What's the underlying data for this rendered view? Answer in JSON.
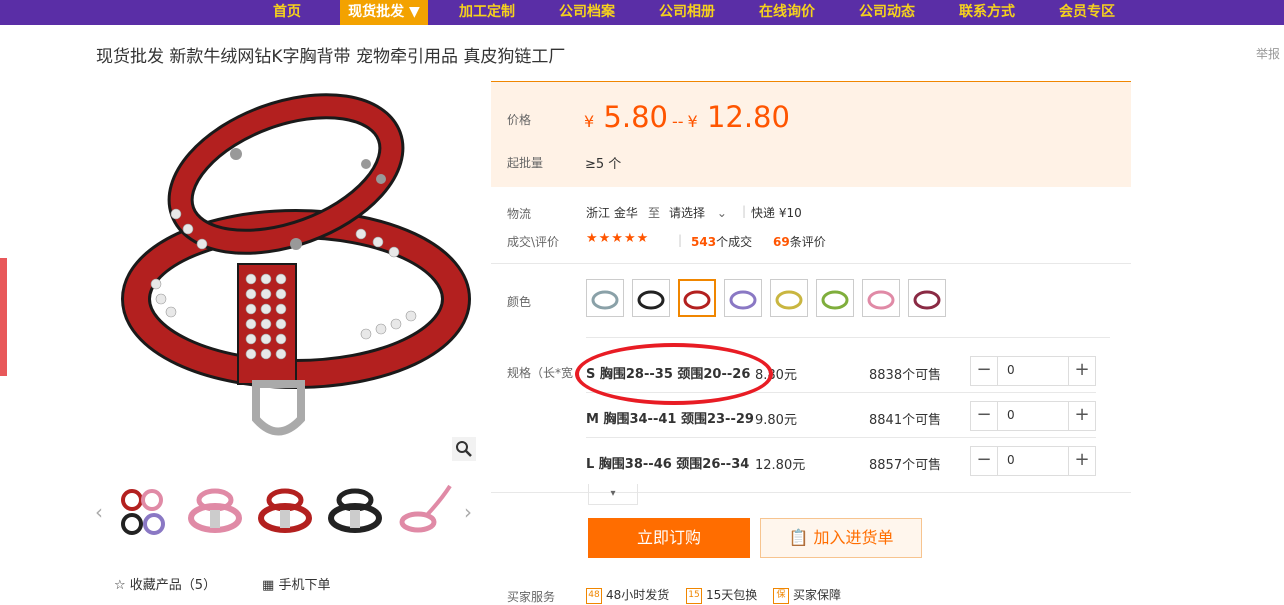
{
  "nav": {
    "items": [
      {
        "label": "首页"
      },
      {
        "label": "现货批发 ▼"
      },
      {
        "label": "加工定制"
      },
      {
        "label": "公司档案"
      },
      {
        "label": "公司相册"
      },
      {
        "label": "在线询价"
      },
      {
        "label": "公司动态"
      },
      {
        "label": "联系方式"
      },
      {
        "label": "会员专区"
      }
    ]
  },
  "product": {
    "title": "现货批发 新款牛绒网钻K字胸背带 宠物牵引用品 真皮狗链工厂",
    "report": "举报"
  },
  "price": {
    "label": "价格",
    "currency": "¥",
    "low": "5.80",
    "sep": "--",
    "high": "12.80",
    "moq_label": "起批量",
    "moq_value": "≥5 个"
  },
  "logistics": {
    "label": "物流",
    "origin": "浙江 金华",
    "to": "至",
    "select": "请选择",
    "express": "快递 ¥10"
  },
  "deals": {
    "label": "成交\\评价",
    "rating_stars": 5,
    "stars_text": "★★★★★",
    "deals_count": "543",
    "deals_suffix": "个成交",
    "reviews_count": "69",
    "reviews_suffix": "条评价"
  },
  "colors": {
    "label": "颜色",
    "swatches": [
      "gray-blue",
      "black",
      "red",
      "purple",
      "yellow",
      "green",
      "pink",
      "wine"
    ]
  },
  "specs": {
    "label": "规格（长*宽",
    "rows": [
      {
        "name": "S 胸围28--35 颈围20--26",
        "price": "8.80元",
        "stock": "8838个可售",
        "qty": "0"
      },
      {
        "name": "M 胸围34--41 颈围23--29",
        "price": "9.80元",
        "stock": "8841个可售",
        "qty": "0"
      },
      {
        "name": "L 胸围38--46 颈围26--34",
        "price": "12.80元",
        "stock": "8857个可售",
        "qty": "0"
      }
    ]
  },
  "actions": {
    "buy": "立即订购",
    "cart": "加入进货单"
  },
  "gallery": {
    "favorite": "收藏产品（5）",
    "mobile_order": "手机下单"
  },
  "services": {
    "label": "买家服务",
    "items": [
      {
        "icon": "48",
        "text": "48小时发货"
      },
      {
        "icon": "15",
        "text": "15天包换"
      },
      {
        "icon": "保",
        "text": "买家保障"
      }
    ]
  },
  "theme": {
    "nav_bg": "#5a2ea6",
    "nav_text": "#f6d21c",
    "accent": "#ff5500",
    "buy_bg": "#ff6d00"
  }
}
